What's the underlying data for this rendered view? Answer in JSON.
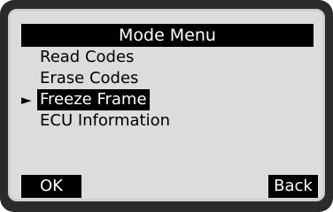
{
  "title": "Mode Menu",
  "menu": {
    "items": [
      {
        "label": "Read Codes",
        "selected": false
      },
      {
        "label": "Erase Codes",
        "selected": false
      },
      {
        "label": "Freeze Frame",
        "selected": true
      },
      {
        "label": "ECU Information",
        "selected": false
      }
    ],
    "pointer_glyph": "►"
  },
  "softkeys": {
    "ok": "OK",
    "back": "Back"
  },
  "colors": {
    "screen_bg": "#dcdcdc",
    "bezel": "#2b2b2b",
    "highlight": "#000000"
  }
}
